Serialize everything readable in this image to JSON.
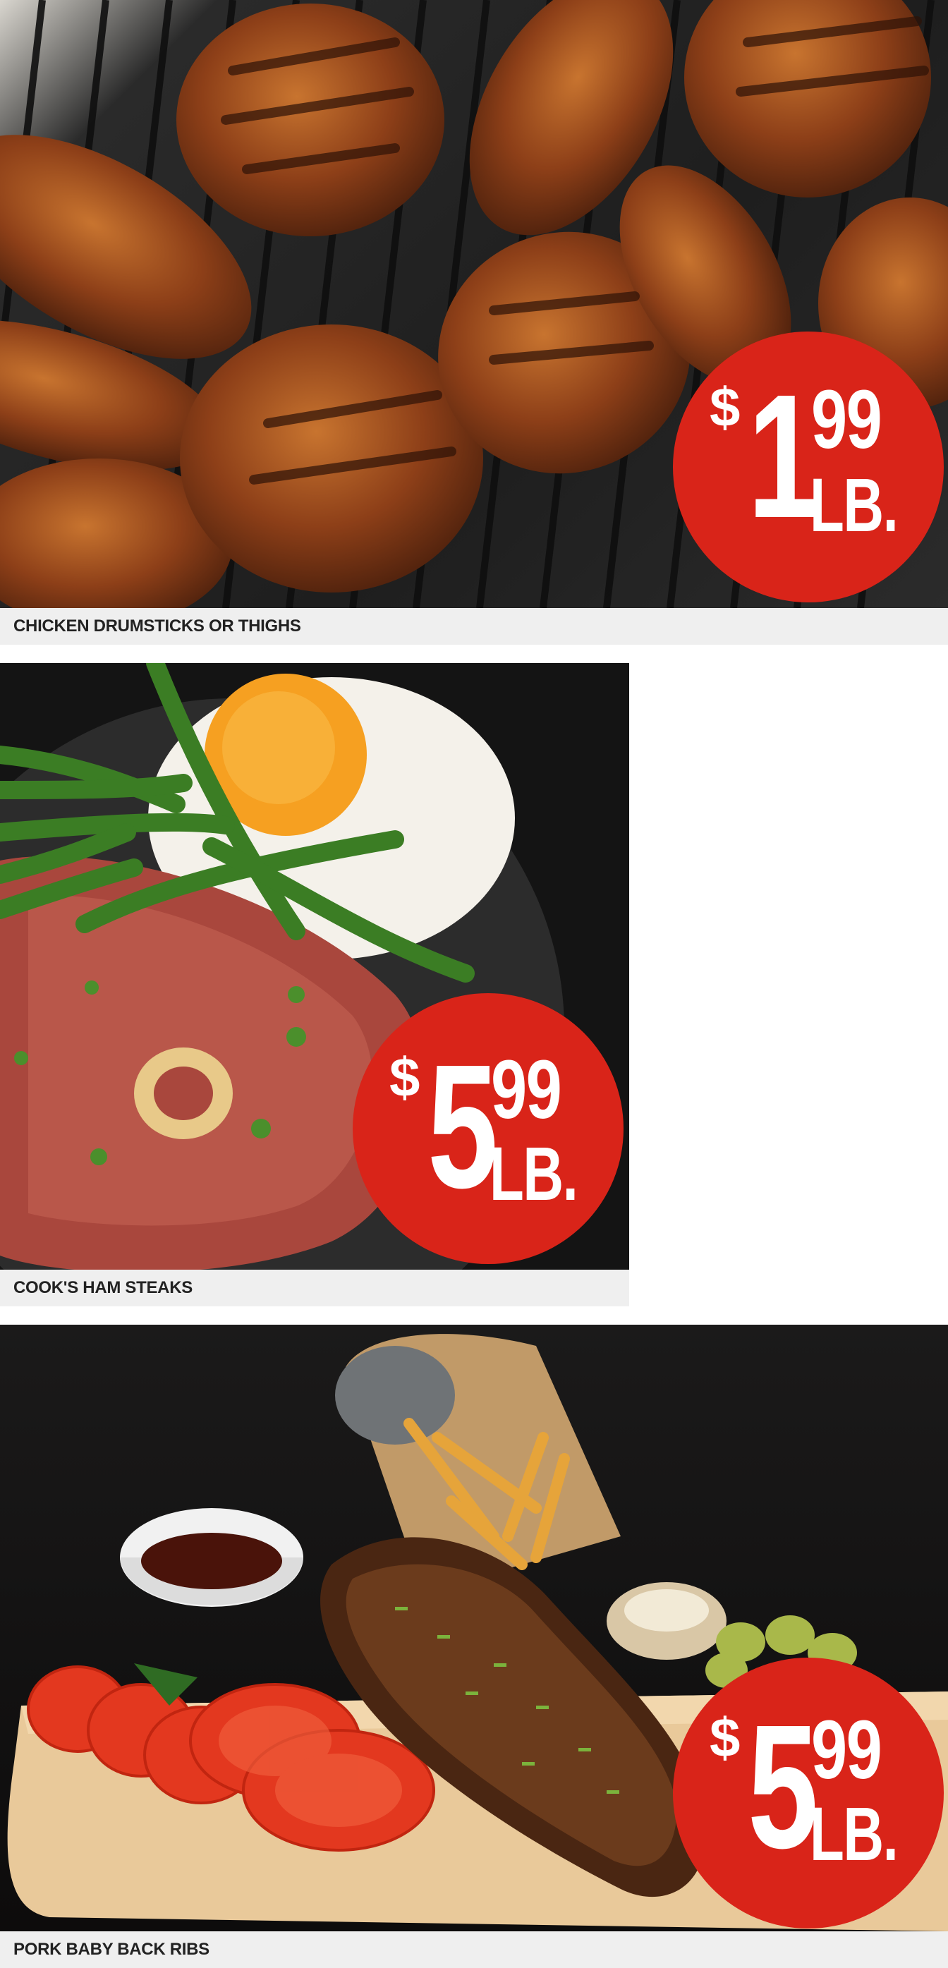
{
  "products": [
    {
      "name": "CHICKEN DRUMSTICKS OR THIGHS",
      "price": {
        "currency": "$",
        "whole": "1",
        "cents": "99",
        "unit": "LB."
      },
      "image": "chicken-drumsticks-thighs-photo"
    },
    {
      "name": "COOK'S HAM STEAKS",
      "price": {
        "currency": "$",
        "whole": "5",
        "cents": "99",
        "unit": "LB."
      },
      "image": "ham-steak-photo"
    },
    {
      "name": "PORK BABY BACK RIBS",
      "price": {
        "currency": "$",
        "whole": "5",
        "cents": "99",
        "unit": "LB."
      },
      "image": "pork-ribs-photo"
    }
  ],
  "colors": {
    "badge": "#d92419",
    "caption_bg": "#efefef",
    "caption_text": "#222222"
  }
}
